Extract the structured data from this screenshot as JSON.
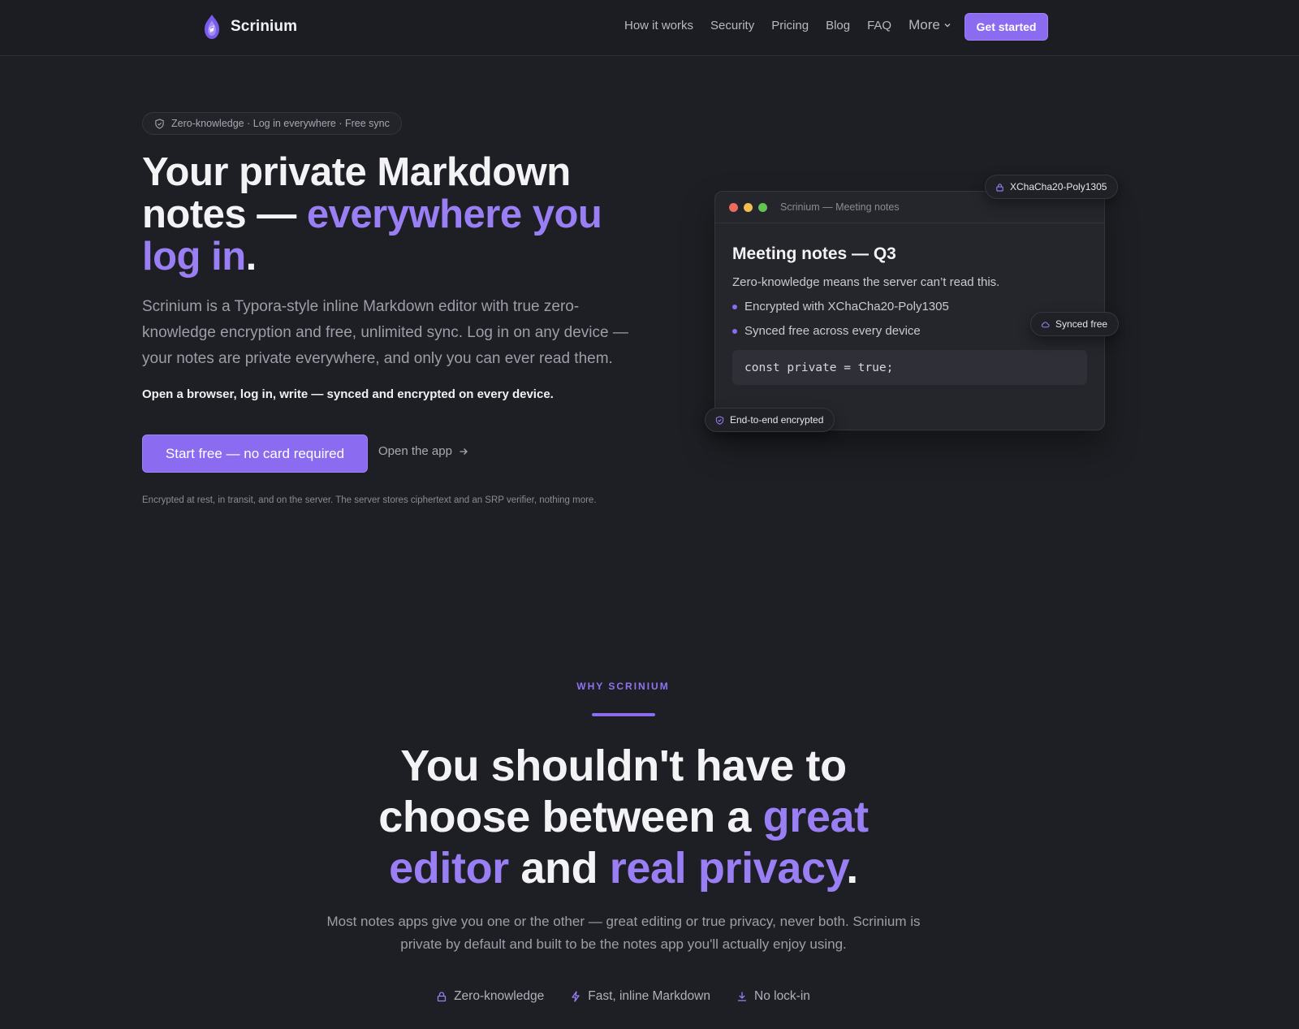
{
  "header": {
    "brand_name": "Scrinium",
    "logo_icon": "scroll-flame-logo",
    "nav": [
      "How it works",
      "Security",
      "Pricing",
      "Blog",
      "FAQ"
    ],
    "more_label": "More",
    "cta_label": "Get started"
  },
  "hero": {
    "pill_text": "Zero-knowledge · Log in everywhere · Free sync",
    "title_part1": "Your private Markdown notes — ",
    "title_accent": "everywhere you log in",
    "title_end": ".",
    "description": "Scrinium is a Typora-style inline Markdown editor with true zero-knowledge encryption and free, unlimited sync. Log in on any device — your notes are private everywhere, and only you can ever read them.",
    "strong_line": "Open a browser, log in, write — synced and encrypted on every device.",
    "primary_cta": "Start free — no card required",
    "secondary_cta": "Open the app",
    "fine_print": "Encrypted at rest, in transit, and on the server. The server stores ciphertext and an SRP verifier, nothing more."
  },
  "card": {
    "window_title": "Scrinium — Meeting notes",
    "heading": "Meeting notes — Q3",
    "paragraph": "Zero-knowledge means the server can’t read this.",
    "bullets": [
      "Encrypted with XChaCha20-Poly1305",
      "Synced free across every device"
    ],
    "code": "const private = true;",
    "chip_crypto": "XChaCha20-Poly1305",
    "chip_sync": "Synced free",
    "chip_e2e": "End-to-end encrypted"
  },
  "why": {
    "eyebrow": "WHY SCRINIUM",
    "title_1": "You shouldn't have to choose between a ",
    "title_accent1": "great editor",
    "title_2": " and ",
    "title_accent2": "real privacy",
    "title_end": ".",
    "description": "Most notes apps give you one or the other — great editing or true privacy, never both. Scrinium is private by default and built to be the notes app you'll actually enjoy using.",
    "features": [
      {
        "icon": "lock-icon",
        "label": "Zero-knowledge"
      },
      {
        "icon": "bolt-icon",
        "label": "Fast, inline Markdown"
      },
      {
        "icon": "download-icon",
        "label": "No lock-in"
      }
    ]
  },
  "colors": {
    "background": "#1e1f24",
    "accent": "#8b6cf0",
    "accent_text": "#9a7ff4"
  }
}
